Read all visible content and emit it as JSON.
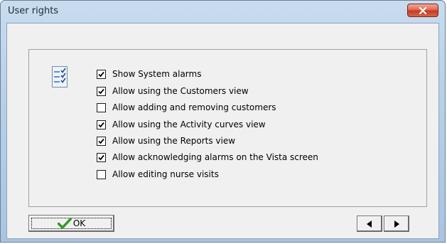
{
  "window": {
    "title": "User rights"
  },
  "options": [
    {
      "label": "Show System alarms",
      "checked": true
    },
    {
      "label": "Allow using the Customers view",
      "checked": true
    },
    {
      "label": "Allow adding and removing customers",
      "checked": false
    },
    {
      "label": "Allow using the Activity curves view",
      "checked": true
    },
    {
      "label": "Allow using the Reports view",
      "checked": true
    },
    {
      "label": "Allow acknowledging alarms on the Vista screen",
      "checked": true
    },
    {
      "label": "Allow editing nurse visits",
      "checked": false
    }
  ],
  "buttons": {
    "ok_label": "OK",
    "prev_icon": "triangle-left-icon",
    "next_icon": "triangle-right-icon"
  },
  "icons": {
    "header_icon": "checklist-icon",
    "close_icon": "close-icon",
    "ok_icon": "checkmark-icon"
  },
  "colors": {
    "close_button": "#c9452d",
    "checkmark_green": "#2f9a1e",
    "titlebar": "#b9d1ea"
  }
}
